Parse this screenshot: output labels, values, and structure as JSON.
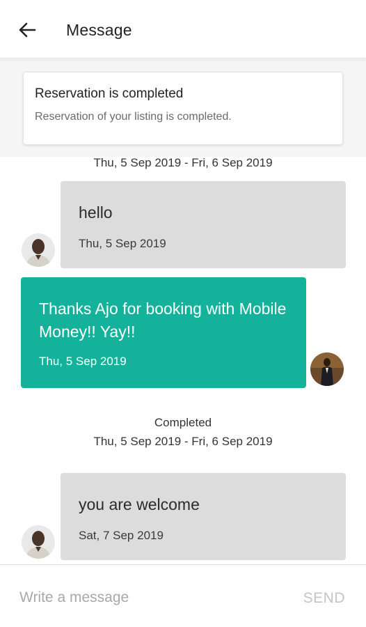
{
  "appbar": {
    "title": "Message"
  },
  "banner": {
    "title": "Reservation is completed",
    "subtitle": "Reservation of your listing is completed."
  },
  "messages": [
    {
      "direction": "incoming",
      "header_range": "Thu, 5 Sep 2019 - Fri, 6 Sep 2019",
      "text": "hello",
      "date": "Thu, 5 Sep 2019",
      "avatar": "host-avatar"
    },
    {
      "direction": "outgoing",
      "text": "Thanks Ajo for booking with Mobile Money!! Yay!!",
      "date": "Thu, 5 Sep 2019",
      "avatar": "guest-avatar"
    },
    {
      "direction": "incoming",
      "status": "Completed",
      "header_range": "Thu, 5 Sep 2019 - Fri, 6 Sep 2019",
      "text": "you are welcome",
      "date": "Sat, 7 Sep 2019",
      "avatar": "host-avatar"
    }
  ],
  "composer": {
    "placeholder": "Write a message",
    "send_label": "SEND"
  },
  "colors": {
    "accent": "#14b19b",
    "incoming_bubble": "#dcdcdc",
    "send_disabled": "#c4c4c4"
  },
  "icons": {
    "back": "arrow-left-icon"
  }
}
